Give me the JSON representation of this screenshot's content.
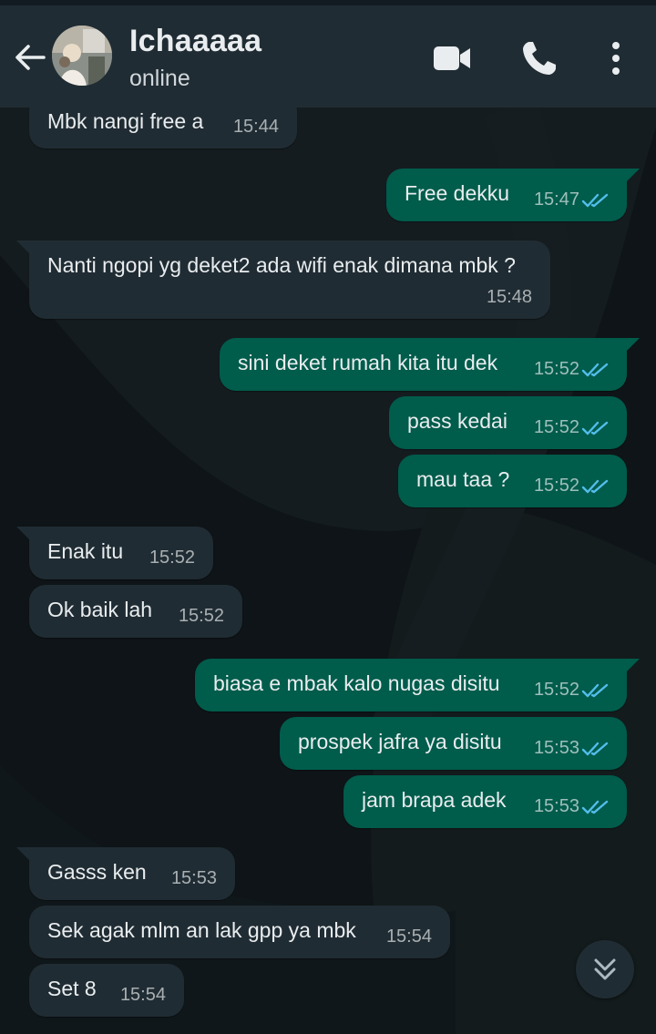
{
  "header": {
    "contact_name": "Ichaaaaa",
    "status": "online"
  },
  "colors": {
    "header_bg": "#202c33",
    "incoming_bubble": "#202c33",
    "outgoing_bubble": "#005c4b",
    "read_ticks": "#53bdeb",
    "wallpaper": "#0e1519"
  },
  "icons": {
    "back": "arrow-left-icon",
    "video": "video-camera-icon",
    "call": "phone-icon",
    "menu": "more-vertical-icon",
    "scroll": "double-chevron-down-icon",
    "read": "double-check-icon"
  },
  "messages": [
    {
      "dir": "in",
      "text": "Mbk nangi free a",
      "time": "15:44"
    },
    {
      "dir": "out",
      "text": "Free dekku",
      "time": "15:47",
      "read": true
    },
    {
      "dir": "in",
      "text": "Nanti ngopi yg deket2 ada wifi enak dimana mbk ?",
      "time": "15:48"
    },
    {
      "dir": "out",
      "text": "sini deket rumah kita itu dek",
      "time": "15:52",
      "read": true
    },
    {
      "dir": "out",
      "text": "pass kedai",
      "time": "15:52",
      "read": true
    },
    {
      "dir": "out",
      "text": "mau taa ?",
      "time": "15:52",
      "read": true
    },
    {
      "dir": "in",
      "text": "Enak itu",
      "time": "15:52"
    },
    {
      "dir": "in",
      "text": "Ok baik lah",
      "time": "15:52"
    },
    {
      "dir": "out",
      "text": "biasa e mbak kalo nugas disitu",
      "time": "15:52",
      "read": true
    },
    {
      "dir": "out",
      "text": "prospek jafra ya disitu",
      "time": "15:53",
      "read": true
    },
    {
      "dir": "out",
      "text": "jam brapa adek",
      "time": "15:53",
      "read": true
    },
    {
      "dir": "in",
      "text": "Gasss ken",
      "time": "15:53"
    },
    {
      "dir": "in",
      "text": "Sek agak mlm an lak gpp ya mbk",
      "time": "15:54"
    },
    {
      "dir": "in",
      "text": "Set 8",
      "time": "15:54"
    }
  ]
}
